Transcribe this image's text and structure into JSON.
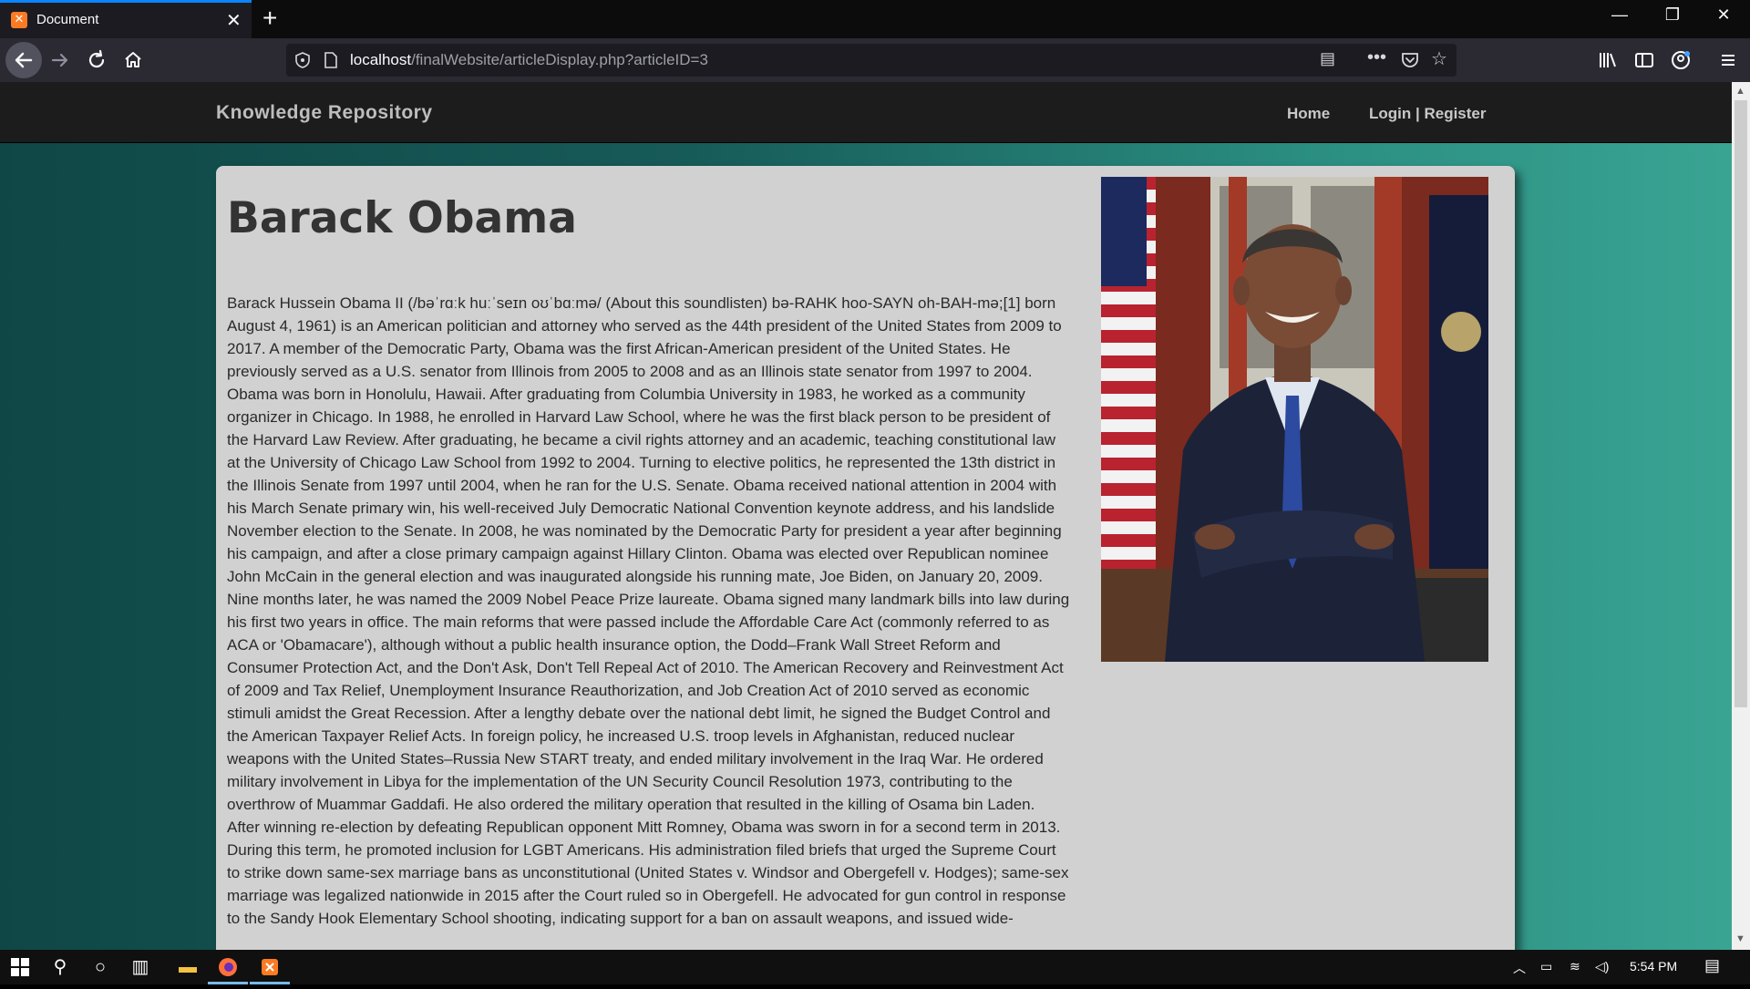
{
  "browser": {
    "tab_title": "Document",
    "tab_close": "✕",
    "new_tab": "+",
    "url_host": "localhost",
    "url_path": "/finalWebsite/articleDisplay.php?articleID=3",
    "window_controls": {
      "minimize": "—",
      "restore": "❐",
      "close": "✕"
    }
  },
  "site": {
    "brand": "Knowledge Repository",
    "nav": {
      "home": "Home",
      "auth": "Login | Register"
    }
  },
  "article": {
    "title": "Barack Obama",
    "body": "Barack Hussein Obama II (/bəˈrɑːk huːˈseɪn oʊˈbɑːmə/ (About this soundlisten) bə-RAHK hoo-SAYN oh-BAH-mə;[1] born August 4, 1961) is an American politician and attorney who served as the 44th president of the United States from 2009 to 2017. A member of the Democratic Party, Obama was the first African-American president of the United States. He previously served as a U.S. senator from Illinois from 2005 to 2008 and as an Illinois state senator from 1997 to 2004. Obama was born in Honolulu, Hawaii. After graduating from Columbia University in 1983, he worked as a community organizer in Chicago. In 1988, he enrolled in Harvard Law School, where he was the first black person to be president of the Harvard Law Review. After graduating, he became a civil rights attorney and an academic, teaching constitutional law at the University of Chicago Law School from 1992 to 2004. Turning to elective politics, he represented the 13th district in the Illinois Senate from 1997 until 2004, when he ran for the U.S. Senate. Obama received national attention in 2004 with his March Senate primary win, his well-received July Democratic National Convention keynote address, and his landslide November election to the Senate. In 2008, he was nominated by the Democratic Party for president a year after beginning his campaign, and after a close primary campaign against Hillary Clinton. Obama was elected over Republican nominee John McCain in the general election and was inaugurated alongside his running mate, Joe Biden, on January 20, 2009. Nine months later, he was named the 2009 Nobel Peace Prize laureate. Obama signed many landmark bills into law during his first two years in office. The main reforms that were passed include the Affordable Care Act (commonly referred to as ACA or 'Obamacare'), although without a public health insurance option, the Dodd–Frank Wall Street Reform and Consumer Protection Act, and the Don't Ask, Don't Tell Repeal Act of 2010. The American Recovery and Reinvestment Act of 2009 and Tax Relief, Unemployment Insurance Reauthorization, and Job Creation Act of 2010 served as economic stimuli amidst the Great Recession. After a lengthy debate over the national debt limit, he signed the Budget Control and the American Taxpayer Relief Acts. In foreign policy, he increased U.S. troop levels in Afghanistan, reduced nuclear weapons with the United States–Russia New START treaty, and ended military involvement in the Iraq War. He ordered military involvement in Libya for the implementation of the UN Security Council Resolution 1973, contributing to the overthrow of Muammar Gaddafi. He also ordered the military operation that resulted in the killing of Osama bin Laden. After winning re-election by defeating Republican opponent Mitt Romney, Obama was sworn in for a second term in 2013. During this term, he promoted inclusion for LGBT Americans. His administration filed briefs that urged the Supreme Court to strike down same-sex marriage bans as unconstitutional (United States v. Windsor and Obergefell v. Hodges); same-sex marriage was legalized nationwide in 2015 after the Court ruled so in Obergefell. He advocated for gun control in response to the Sandy Hook Elementary School shooting, indicating support for a ban on assault weapons, and issued wide-"
  },
  "taskbar": {
    "time": "5:54 PM"
  }
}
